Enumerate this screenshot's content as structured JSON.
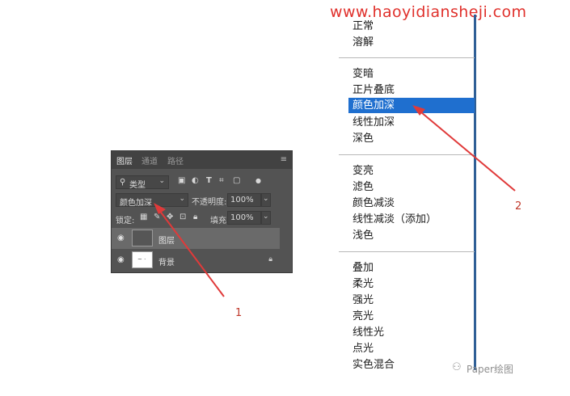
{
  "watermark": "www.haoyidiansheji.com",
  "layers_panel": {
    "tabs": [
      "图层",
      "通道",
      "路径"
    ],
    "menu_icon": "≡",
    "filter_kind": "类型",
    "blend_mode": "颜色加深",
    "opacity_label": "不透明度:",
    "opacity_value": "100%",
    "lock_label": "锁定:",
    "fill_label": "填充:",
    "fill_value": "100%",
    "layers": [
      {
        "name": "图层"
      },
      {
        "name": "背景"
      }
    ]
  },
  "blend_menu": {
    "items": [
      "正常",
      "溶解",
      "变暗",
      "正片叠底",
      "颜色加深",
      "线性加深",
      "深色",
      "变亮",
      "滤色",
      "颜色减淡",
      "线性减淡（添加）",
      "浅色",
      "叠加",
      "柔光",
      "强光",
      "亮光",
      "线性光",
      "点光",
      "实色混合"
    ],
    "selected": "颜色加深"
  },
  "annotations": {
    "label_1": "1",
    "label_2": "2"
  },
  "credit": "Paper绘图",
  "colors": {
    "highlight": "#1f6fcf",
    "arrow": "#e03a3a",
    "watermark": "#e0312c",
    "panel": "#535353"
  }
}
